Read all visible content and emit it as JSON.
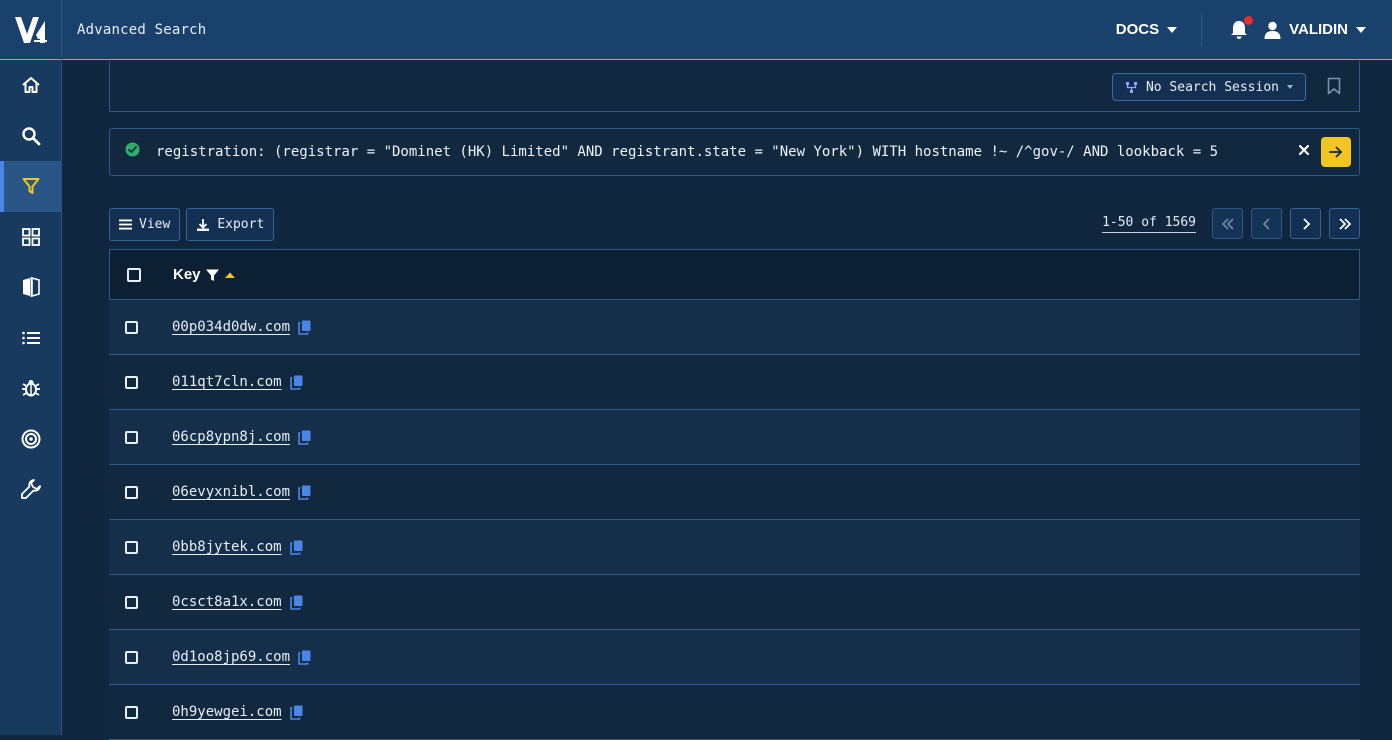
{
  "app": {
    "logo_text": "V",
    "title": "Advanced Search"
  },
  "header": {
    "docs_label": "DOCS",
    "user_label": "VALIDIN"
  },
  "sidebar": {
    "items": [
      {
        "icon": "home-icon"
      },
      {
        "icon": "search-icon"
      },
      {
        "icon": "filter-icon",
        "active": true
      },
      {
        "icon": "grid-icon"
      },
      {
        "icon": "compare-icon"
      },
      {
        "icon": "list-icon"
      },
      {
        "icon": "bug-icon"
      },
      {
        "icon": "target-icon"
      },
      {
        "icon": "wrench-icon"
      }
    ]
  },
  "session": {
    "label": "No Search Session"
  },
  "query": {
    "text": "registration: (registrar = \"Dominet (HK) Limited\" AND registrant.state = \"New York\") WITH hostname !~ /^gov-/ AND lookback = 5"
  },
  "toolbar": {
    "view_label": "View",
    "export_label": "Export"
  },
  "pagination": {
    "info": "1-50 of 1569"
  },
  "table": {
    "key_header": "Key",
    "rows": [
      "00p034d0dw.com",
      "011qt7cln.com",
      "06cp8ypn8j.com",
      "06evyxnibl.com",
      "0bb8jytek.com",
      "0csct8a1x.com",
      "0d1oo8jp69.com",
      "0h9yewgei.com"
    ]
  },
  "colors": {
    "accent": "#f3c521",
    "link_icon": "#4a86e8",
    "success": "#2fae6a",
    "notification": "#e8302c"
  }
}
